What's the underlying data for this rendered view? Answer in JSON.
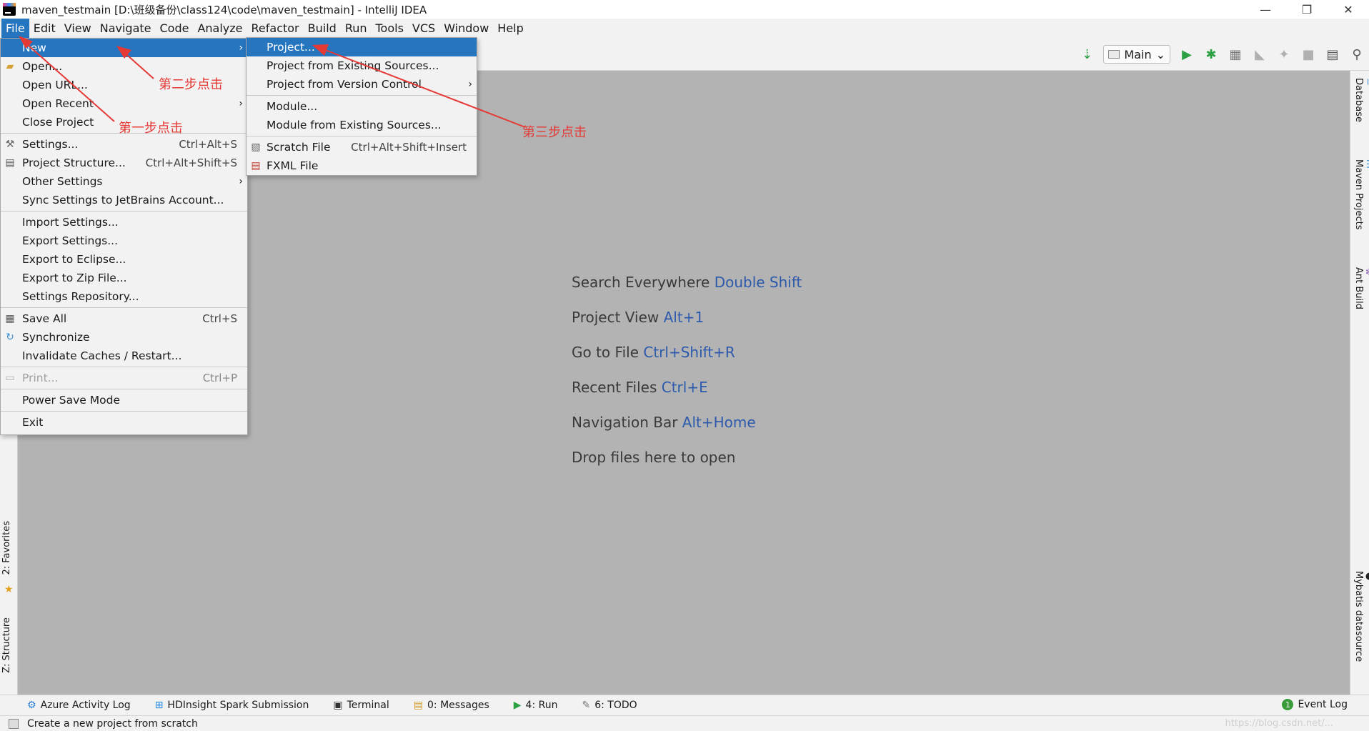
{
  "window": {
    "title": "maven_testmain [D:\\班级备份\\class124\\code\\maven_testmain] - IntelliJ IDEA",
    "controls": [
      "—",
      "❐",
      "✕"
    ]
  },
  "menubar": {
    "items": [
      "File",
      "Edit",
      "View",
      "Navigate",
      "Code",
      "Analyze",
      "Refactor",
      "Build",
      "Run",
      "Tools",
      "VCS",
      "Window",
      "Help"
    ]
  },
  "toolbar": {
    "run_config": "Main",
    "icons": [
      "build-icon",
      "run-icon",
      "debug-icon",
      "coverage-icon",
      "profile-icon",
      "attach-icon",
      "stop-icon",
      "project-structure-icon",
      "search-icon"
    ]
  },
  "file_menu": {
    "items": [
      {
        "label": "New",
        "shortcut": "",
        "submenu": true
      },
      {
        "label": "Open...",
        "shortcut": "",
        "submenu": false
      },
      {
        "label": "Open URL...",
        "shortcut": "",
        "submenu": false
      },
      {
        "label": "Open Recent",
        "shortcut": "",
        "submenu": true
      },
      {
        "label": "Close Project",
        "shortcut": "",
        "submenu": false
      },
      {
        "label": "Settings...",
        "shortcut": "Ctrl+Alt+S",
        "submenu": false
      },
      {
        "label": "Project Structure...",
        "shortcut": "Ctrl+Alt+Shift+S",
        "submenu": false
      },
      {
        "label": "Other Settings",
        "shortcut": "",
        "submenu": true
      },
      {
        "label": "Sync Settings to JetBrains Account...",
        "shortcut": "",
        "submenu": false
      },
      {
        "label": "Import Settings...",
        "shortcut": "",
        "submenu": false
      },
      {
        "label": "Export Settings...",
        "shortcut": "",
        "submenu": false
      },
      {
        "label": "Export to Eclipse...",
        "shortcut": "",
        "submenu": false
      },
      {
        "label": "Export to Zip File...",
        "shortcut": "",
        "submenu": false
      },
      {
        "label": "Settings Repository...",
        "shortcut": "",
        "submenu": false
      },
      {
        "label": "Save All",
        "shortcut": "Ctrl+S",
        "submenu": false
      },
      {
        "label": "Synchronize",
        "shortcut": "",
        "submenu": false
      },
      {
        "label": "Invalidate Caches / Restart...",
        "shortcut": "",
        "submenu": false
      },
      {
        "label": "Print...",
        "shortcut": "Ctrl+P",
        "submenu": false
      },
      {
        "label": "Power Save Mode",
        "shortcut": "",
        "submenu": false
      },
      {
        "label": "Exit",
        "shortcut": "",
        "submenu": false
      }
    ]
  },
  "new_submenu": {
    "items": [
      {
        "label": "Project...",
        "shortcut": ""
      },
      {
        "label": "Project from Existing Sources...",
        "shortcut": ""
      },
      {
        "label": "Project from Version Control",
        "shortcut": ""
      },
      {
        "label": "Module...",
        "shortcut": ""
      },
      {
        "label": "Module from Existing Sources...",
        "shortcut": ""
      },
      {
        "label": "Scratch File",
        "shortcut": "Ctrl+Alt+Shift+Insert"
      },
      {
        "label": "FXML File",
        "shortcut": ""
      }
    ]
  },
  "editor_hints": [
    {
      "text": "Search Everywhere",
      "key": "Double Shift"
    },
    {
      "text": "Project View",
      "key": "Alt+1"
    },
    {
      "text": "Go to File",
      "key": "Ctrl+Shift+R"
    },
    {
      "text": "Recent Files",
      "key": "Ctrl+E"
    },
    {
      "text": "Navigation Bar",
      "key": "Alt+Home"
    },
    {
      "text": "Drop files here to open",
      "key": ""
    }
  ],
  "left_tabs": [
    "2: Favorites",
    "Z: Structure"
  ],
  "right_tabs": [
    "Database",
    "Maven Projects",
    "Ant Build",
    "Mybatis datasource"
  ],
  "bottom_tabs": [
    "Azure Activity Log",
    "HDInsight Spark Submission",
    "Terminal",
    "0: Messages",
    "4: Run",
    "6: TODO"
  ],
  "event_log": {
    "count": "1",
    "label": "Event Log"
  },
  "status": {
    "text": "Create a new project from scratch",
    "watermark": "https://blog.csdn.net/..."
  },
  "annotations": {
    "step1": "第一步点击",
    "step2": "第二步点击",
    "step3": "第三步点击",
    "color": "#e53935"
  }
}
